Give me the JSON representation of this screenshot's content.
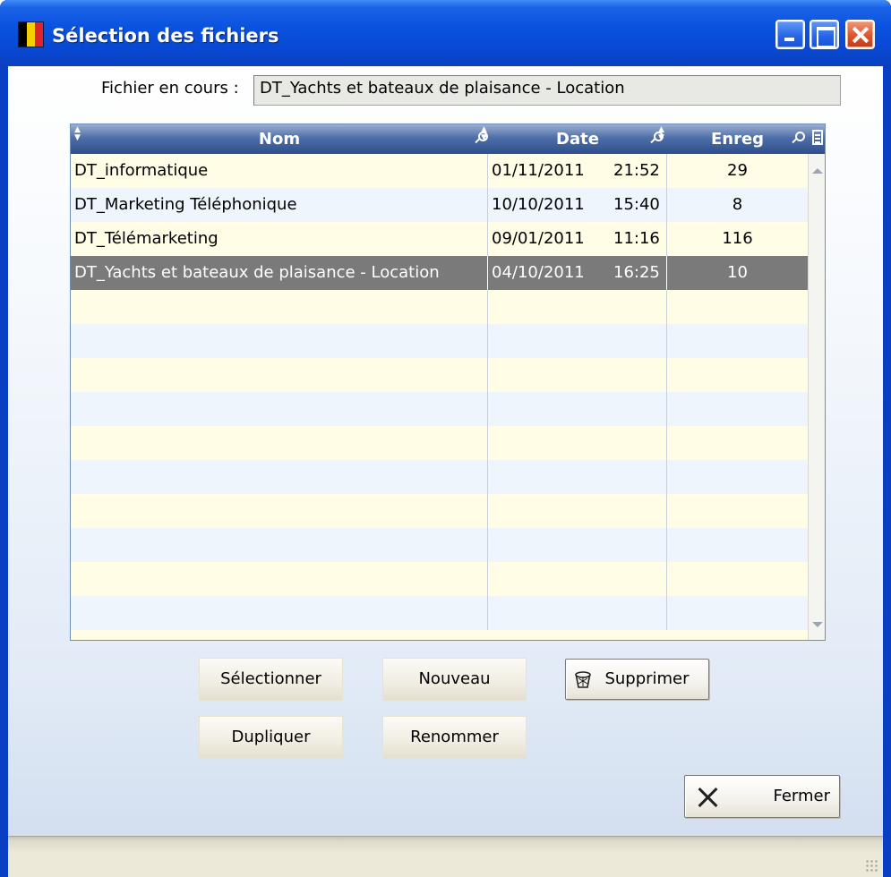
{
  "window": {
    "title": "Sélection des fichiers",
    "flag_colors": [
      "#000000",
      "#f4d000",
      "#e0242c"
    ]
  },
  "current_file": {
    "label": "Fichier en cours :",
    "value": "DT_Yachts et bateaux de plaisance - Location"
  },
  "table": {
    "columns": [
      "Nom",
      "Date",
      "Enreg"
    ],
    "rows": [
      {
        "nom": "DT_informatique",
        "date": "01/11/2011",
        "time": "21:52",
        "enreg": "29"
      },
      {
        "nom": "DT_Marketing Téléphonique",
        "date": "10/10/2011",
        "time": "15:40",
        "enreg": "8"
      },
      {
        "nom": "DT_Télémarketing",
        "date": "09/01/2011",
        "time": "11:16",
        "enreg": "116"
      },
      {
        "nom": "DT_Yachts et bateaux de plaisance - Location",
        "date": "04/10/2011",
        "time": "16:25",
        "enreg": "10"
      }
    ],
    "selected_row": 3,
    "empty_row_count": 10
  },
  "buttons": {
    "select": "Sélectionner",
    "new": "Nouveau",
    "delete": "Supprimer",
    "duplicate": "Dupliquer",
    "rename": "Renommer",
    "close": "Fermer"
  },
  "colors": {
    "titlebar": "#0a53e0",
    "header": "#2e4e8c",
    "row_odd": "#fffde6",
    "row_even": "#eef5fc",
    "row_selected": "#7a7a7a"
  }
}
